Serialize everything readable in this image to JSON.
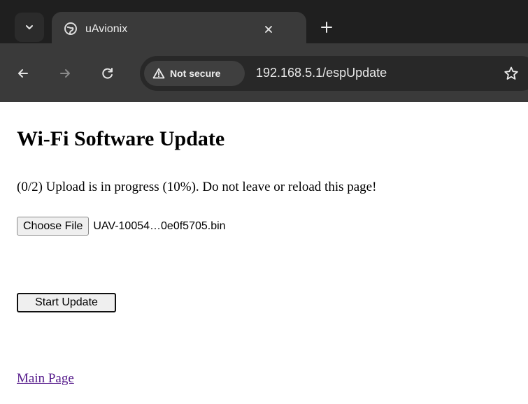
{
  "browser": {
    "tab": {
      "title": "uAvionix"
    },
    "address_bar": {
      "security_label": "Not secure",
      "url": "192.168.5.1/espUpdate"
    },
    "icons": [
      "tab-search-chevron-icon",
      "globe-icon",
      "close-icon",
      "plus-icon",
      "back-arrow-icon",
      "forward-arrow-icon",
      "reload-icon",
      "warning-triangle-icon",
      "star-icon"
    ],
    "colors": {
      "tabstrip": "#1f1f1f",
      "toolbar": "#3a3a3a",
      "omnibox": "#282828"
    }
  },
  "page": {
    "heading": "Wi-Fi Software Update",
    "status": "(0/2) Upload is in progress (10%). Do not leave or reload this page!",
    "file_input": {
      "button_label": "Choose File",
      "file_name": "UAV-10054…0e0f5705.bin"
    },
    "start_button": "Start Update",
    "main_link": "Main Page",
    "colors": {
      "link_visited": "#551a8b"
    }
  }
}
